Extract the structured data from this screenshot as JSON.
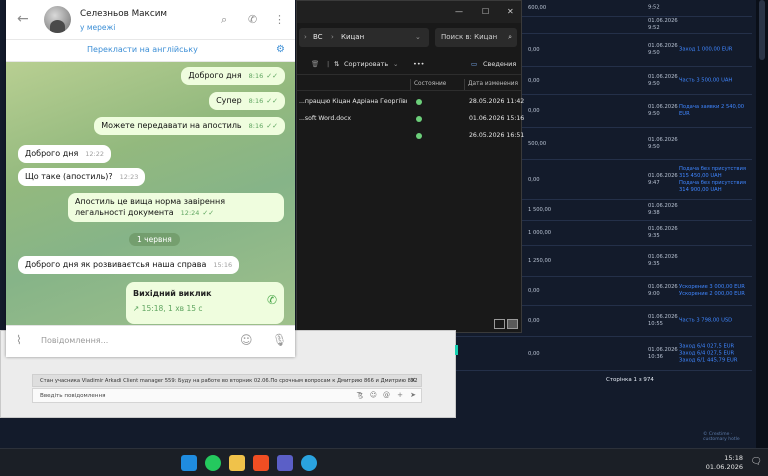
{
  "background_table": {
    "rows": [
      {
        "amount": "600,00",
        "date": "9:52",
        "link": ""
      },
      {
        "amount": "",
        "date": "01.06.2026\n9:52",
        "link": ""
      },
      {
        "amount": "0,00",
        "date": "01.06.2026\n9:50",
        "link": "Заход 1 000,00 EUR"
      },
      {
        "amount": "0,00",
        "date": "01.06.2026\n9:50",
        "link": "Часть 3 500,00 UAH"
      },
      {
        "amount": "0,00",
        "date": "01.06.2026\n9:50",
        "link": "Подача заявки 2 540,00\nEUR"
      },
      {
        "amount": "500,00",
        "date": "01.06.2026\n9:50",
        "link": ""
      },
      {
        "amount": "0,00",
        "date": "01.06.2026\n9:47",
        "link": "Подача без присутствия\n315 450,00 UAH\nПодача без присутствия\n314 900,00 UAH"
      },
      {
        "amount": "1 500,00",
        "date": "01.06.2026\n9:38",
        "link": ""
      },
      {
        "amount": "1 000,00",
        "date": "01.06.2026\n9:35",
        "link": ""
      },
      {
        "amount": "1 250,00",
        "date": "01.06.2026\n9:35",
        "link": ""
      },
      {
        "amount": "0,00",
        "date": "01.06.2026\n9:00",
        "link": "Ускорение 3 000,00 EUR\nУскорение 2 000,00 EUR"
      },
      {
        "amount": "0,00",
        "date": "01.06.2026\n10:55",
        "link": "Часть 3 798,00 USD"
      },
      {
        "amount": "0,00",
        "date": "01.06.2026\n10:36",
        "link": "Заход 6/4 027,5 EUR\nЗаход 6/4 027,5 EUR\nЗаход 6/1 445,79 EUR"
      }
    ],
    "pager": "Сторінка 1 з 974",
    "credit": "© Crextime · customary hotle"
  },
  "explorer": {
    "window_controls": [
      "—",
      "☐",
      "✕"
    ],
    "path": [
      "BC",
      "Кицан"
    ],
    "search_placeholder": "Поиск в: Кицан",
    "sort_label": "Сортировать",
    "more_label": "•••",
    "details_label": "Сведения",
    "columns": [
      "Состояние",
      "Дата изменения"
    ],
    "files": [
      {
        "name": "...праццю Кіцан Адріана Георгіївна пі...",
        "date": "28.05.2026 11:42"
      },
      {
        "name": "...soft Word.docx",
        "date": "01.06.2026 15:16"
      },
      {
        "name": "",
        "date": "26.05.2026 16:51"
      }
    ]
  },
  "webchat": {
    "status_line": "Стан учасника Vladimir Arkadi Client manager 559: Буду на работе во вторник 02.06.По срочным вопросам к Дмитрию 866 и Дмитрию 892",
    "input_placeholder": "Введіть повідомлення"
  },
  "telegram": {
    "contact_name": "Селезньов Максим",
    "contact_status": "у мережі",
    "translate_label": "Перекласти на англійську",
    "messages": [
      {
        "text": "Доброго дня",
        "time": "8:16"
      },
      {
        "text": "Супер",
        "time": "8:16"
      },
      {
        "text": "Можете передавати на апостиль",
        "time": "8:16"
      },
      {
        "text": "Доброго дня",
        "time": "12:22"
      },
      {
        "text": "Що таке (апостиль)?",
        "time": "12:23"
      },
      {
        "text": "Апостиль це вища норма завірення легальності документа",
        "time": "12:24"
      },
      {
        "text": "Доброго дня як розвиваєтсья наша справа",
        "time": "15:16"
      }
    ],
    "date_separator": "1 червня",
    "call": {
      "title": "Вихідний виклик",
      "details": "15:18, 1 хв 15 с"
    },
    "compose_placeholder": "Повідомлення..."
  },
  "taskbar": {
    "time": "15:18",
    "date": "01.06.2026",
    "apps": [
      "windows-start",
      "whatsapp",
      "file-explorer",
      "brave-browser",
      "teams",
      "telegram"
    ]
  },
  "colors": {
    "telegram_blue": "#3d8fd6",
    "bubble_out": "#effdde",
    "check_green": "#5fa560",
    "link_blue": "#3f86ff"
  }
}
